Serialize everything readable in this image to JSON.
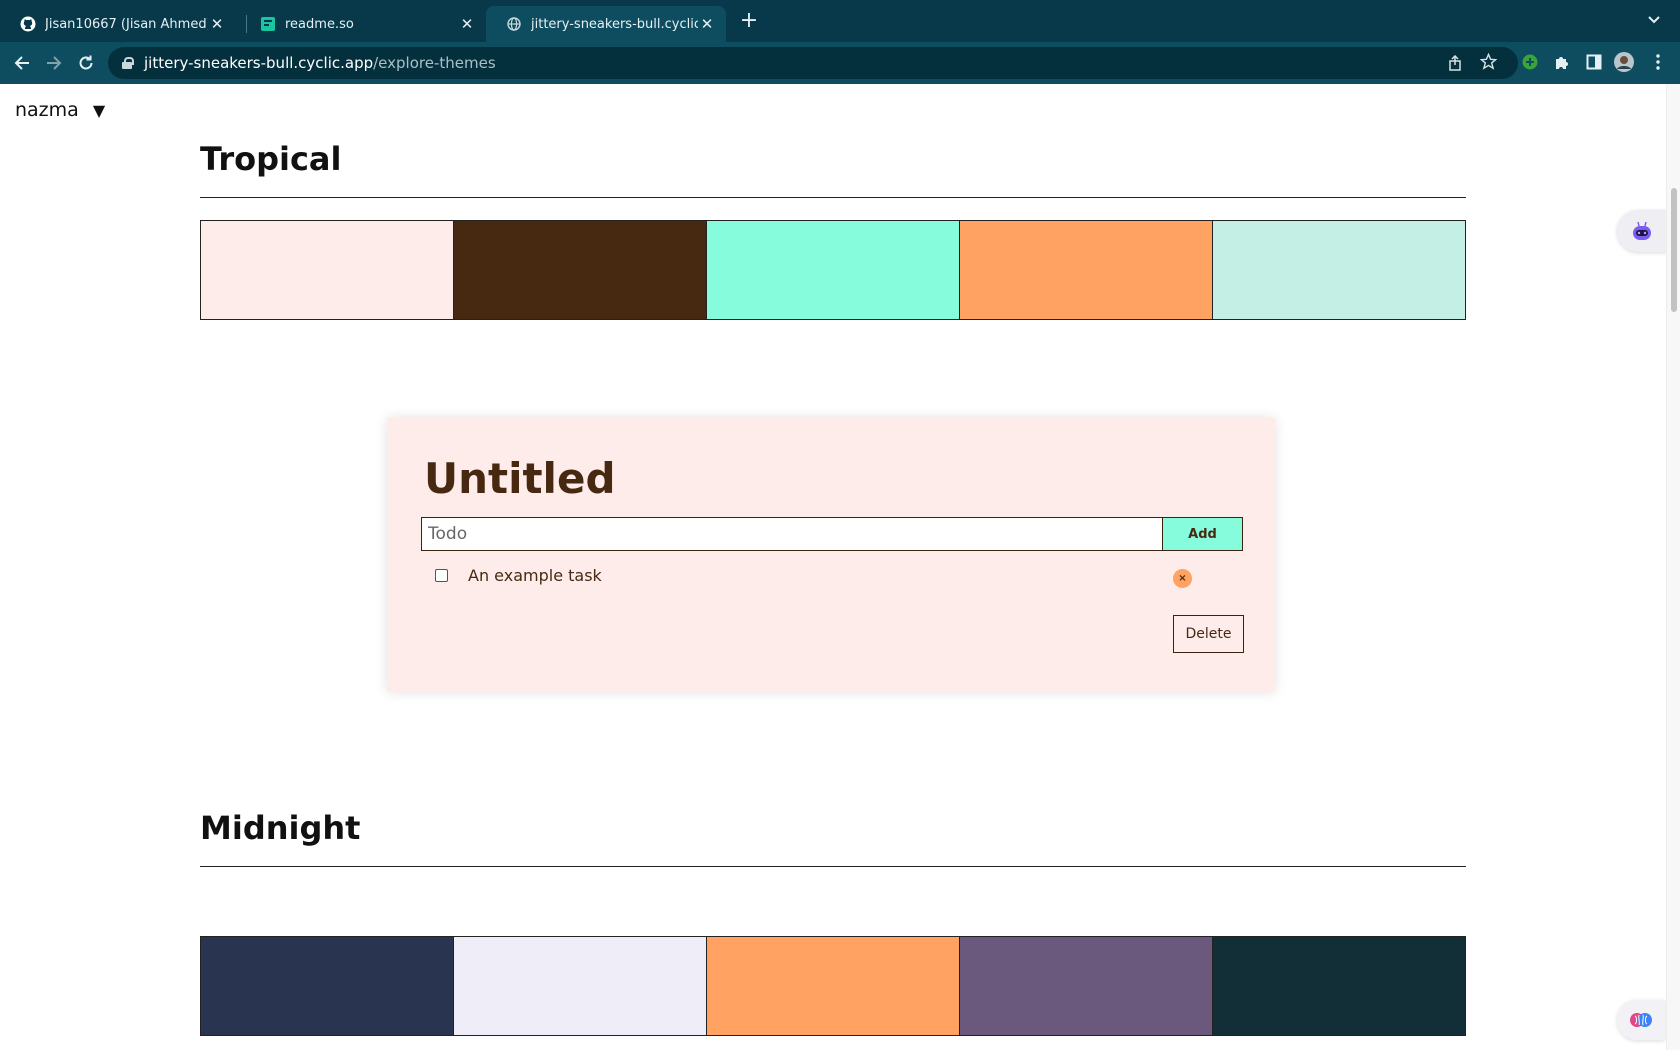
{
  "browser": {
    "tabs": [
      {
        "title": "Jisan10667 (Jisan Ahmed)",
        "icon": "github-icon",
        "active": false
      },
      {
        "title": "readme.so",
        "icon": "readme-so-icon",
        "active": false
      },
      {
        "title": "jittery-sneakers-bull.cyclic.app",
        "icon": "globe-icon",
        "active": true
      }
    ],
    "url_host": "jittery-sneakers-bull.cyclic.app",
    "url_path": "/explore-themes"
  },
  "page": {
    "user_menu": {
      "name": "nazma",
      "caret": "▼"
    },
    "themes": [
      {
        "name": "Tropical",
        "colors": [
          "#fdecea",
          "#472911",
          "#86fcdc",
          "#ffa262",
          "#c4efe4"
        ]
      },
      {
        "name": "Midnight",
        "colors": [
          "#283450",
          "#efedf8",
          "#ffa262",
          "#6b587d",
          "#122e37"
        ]
      }
    ],
    "preview_card": {
      "title": "Untitled",
      "input_placeholder": "Todo",
      "add_label": "Add",
      "tasks": [
        {
          "label": "An example task",
          "done": false
        }
      ],
      "remove_label": "×",
      "delete_label": "Delete",
      "colors": {
        "background": "#fdecea",
        "text": "#472911",
        "button": "#86fcdc",
        "remove": "#ffa262"
      }
    }
  }
}
